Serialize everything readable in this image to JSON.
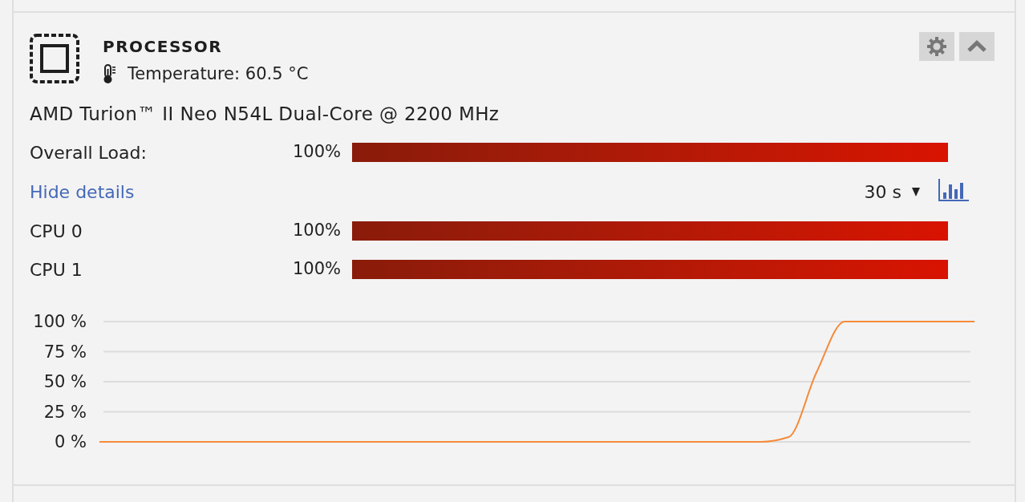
{
  "panel": {
    "title": "PROCESSOR",
    "temperature": "Temperature: 60.5 °C",
    "model": "AMD Turion™ II Neo N54L Dual-Core @ 2200 MHz"
  },
  "overall_load": {
    "label": "Overall Load:",
    "reading": "100%",
    "level": 1
  },
  "details_link": "Hide details",
  "interval": "30 s",
  "cores": [
    {
      "label": "CPU 0",
      "reading": "100%",
      "level": 1
    },
    {
      "label": "CPU 1",
      "reading": "100%",
      "level": 1
    }
  ],
  "chart_data": {
    "type": "line",
    "grid": true,
    "categories": [
      null,
      null,
      null,
      null,
      null,
      null,
      null,
      null,
      null,
      null,
      null,
      null,
      null,
      null,
      null,
      null,
      null,
      null,
      null,
      null,
      null,
      null,
      null,
      null,
      null,
      null,
      null,
      null,
      null,
      null,
      null
    ],
    "ylim": [
      0,
      100
    ],
    "yticks": [
      {
        "value": 0,
        "label": "0 %"
      },
      {
        "value": 25,
        "label": "25 %"
      },
      {
        "value": 50,
        "label": "50 %"
      },
      {
        "value": 75,
        "label": "75 %"
      },
      {
        "value": 100,
        "label": "100 %"
      }
    ],
    "values": [
      0,
      0,
      0,
      0,
      0,
      0,
      0,
      0,
      0,
      0,
      0,
      0,
      0,
      0,
      0,
      0,
      0,
      0,
      0,
      0,
      0,
      0,
      0,
      0,
      4,
      58,
      100,
      100,
      100,
      100,
      100
    ]
  }
}
